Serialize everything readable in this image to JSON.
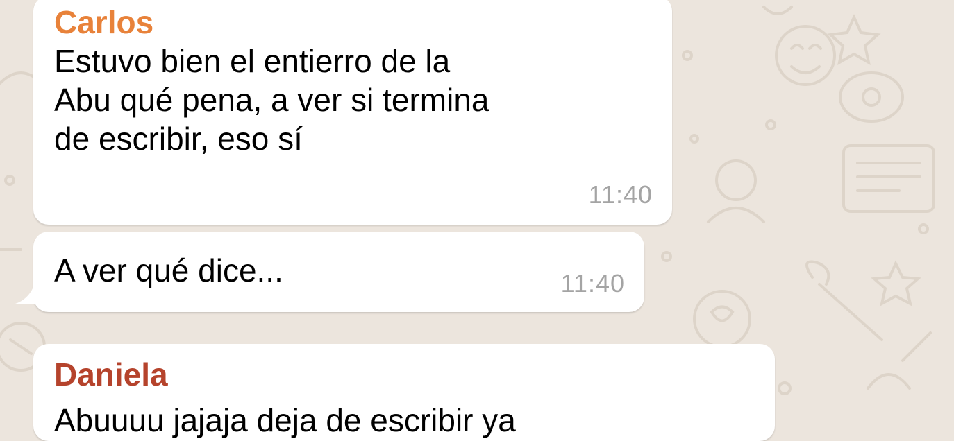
{
  "conversation": {
    "messages": [
      {
        "sender": "Carlos",
        "sender_color": "#e8823a",
        "lines": [
          "Estuvo bien el entierro de la",
          "Abu qué pena, a ver si termina",
          "de escribir, eso sí"
        ],
        "time": "11:40"
      },
      {
        "lines": [
          "A ver qué dice..."
        ],
        "time": "11:40"
      },
      {
        "sender": "Daniela",
        "sender_color": "#b5432c",
        "lines": [
          "Abuuuu jajaja deja de escribir ya"
        ]
      }
    ]
  },
  "colors": {
    "wallpaper": "#ece5dd",
    "bubble": "#ffffff",
    "timestamp": "#a4a4a4"
  }
}
